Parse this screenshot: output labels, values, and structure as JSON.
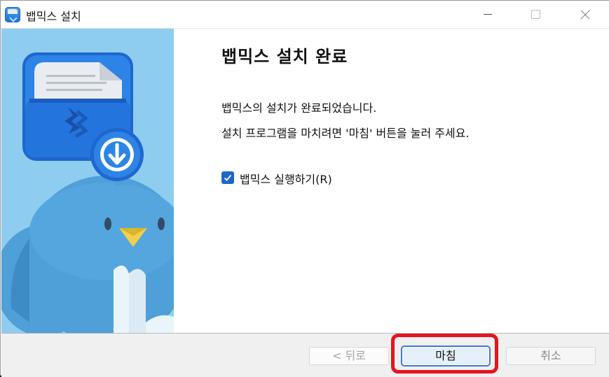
{
  "window": {
    "title": "뱁믹스 설치",
    "icon": "app-box-icon",
    "controls": [
      "minimize-icon",
      "maximize-icon",
      "close-icon"
    ]
  },
  "content": {
    "heading": "뱁믹스 설치 완료",
    "message_line1": "뱁믹스의 설치가 완료되었습니다.",
    "message_line2": "설치 프로그램을 마치려면 '마침' 버튼을 눌러 주세요.",
    "run_checkbox": {
      "label": "뱁믹스 실행하기(R)",
      "checked": true
    }
  },
  "buttons": {
    "back_label": "< 뒤로",
    "finish_label": "마침",
    "cancel_label": "취소"
  },
  "colors": {
    "banner_bg": "#8ecdf0",
    "checkbox_accent": "#1e66c8",
    "highlight": "#e5141f"
  }
}
